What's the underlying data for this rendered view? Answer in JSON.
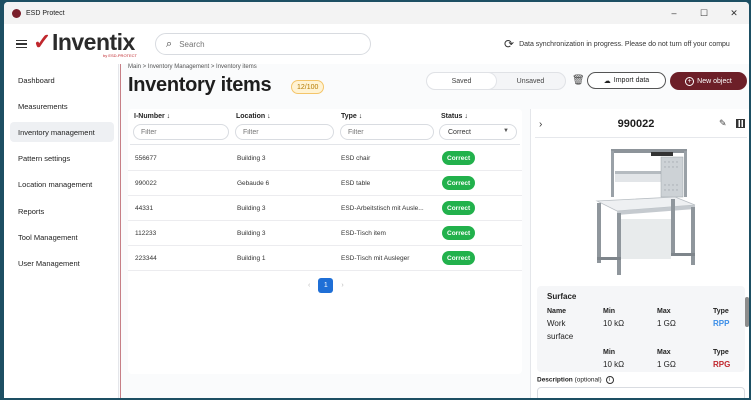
{
  "window": {
    "app_name": "ESD Protect",
    "minimize": "–",
    "maximize": "☐",
    "close": "✕"
  },
  "header": {
    "logo_text": "Inventix",
    "logo_check": "✓",
    "logo_sub": "by ESD-PROTECT",
    "search_placeholder": "Search",
    "sync_text": "Data synchronization in progress. Please do not turn off your compu"
  },
  "sidebar": {
    "items": [
      {
        "label": "Dashboard"
      },
      {
        "label": "Measurements"
      },
      {
        "label": "Inventory management"
      },
      {
        "label": "Pattern settings"
      },
      {
        "label": "Location management"
      },
      {
        "label": "Reports"
      },
      {
        "label": "Tool Management"
      },
      {
        "label": "User Management"
      }
    ],
    "active_index": 2
  },
  "main": {
    "breadcrumb": "Main > Inventory Management > Inventory items",
    "title": "Inventory items",
    "count": "12/100",
    "seg_saved": "Saved",
    "seg_unsaved": "Unsaved",
    "import_label": "Import data",
    "new_label": "New object"
  },
  "table": {
    "headers": [
      "I-Number ↓",
      "Location ↓",
      "Type ↓",
      "Status ↓"
    ],
    "filter_placeholder": "Filter",
    "status_filter_value": "Correct",
    "rows": [
      {
        "number": "556677",
        "location": "Building 3",
        "type": "ESD chair",
        "status": "Correct"
      },
      {
        "number": "990022",
        "location": "Gebaude 6",
        "type": "ESD table",
        "status": "Correct"
      },
      {
        "number": "44331",
        "location": "Building 3",
        "type": "ESD-Arbeitstisch mit Ausle...",
        "status": "Correct"
      },
      {
        "number": "112233",
        "location": "Building 3",
        "type": "ESD-Tisch item",
        "status": "Correct"
      },
      {
        "number": "223344",
        "location": "Building 1",
        "type": "ESD-Tisch mit Ausleger",
        "status": "Correct"
      }
    ],
    "page": "1",
    "prev": "‹",
    "next": "›"
  },
  "detail": {
    "id": "990022",
    "chevron": "›",
    "edit_icon": "✎",
    "surface_title": "Surface",
    "col_name": "Name",
    "col_min": "Min",
    "col_max": "Max",
    "col_type": "Type",
    "row1": {
      "name_a": "Work",
      "name_b": "surface",
      "min": "10 kΩ",
      "max": "1 GΩ",
      "type": "RPP"
    },
    "row2": {
      "min": "10 kΩ",
      "max": "1 GΩ",
      "type": "RPG"
    },
    "desc_label": "Description",
    "desc_optional": "(optional)",
    "info_icon": "i"
  },
  "colors": {
    "brand_red": "#c0272d",
    "primary_button": "#6d1f28",
    "status_green": "#22b14c",
    "pagination_blue": "#1f6fd6"
  }
}
